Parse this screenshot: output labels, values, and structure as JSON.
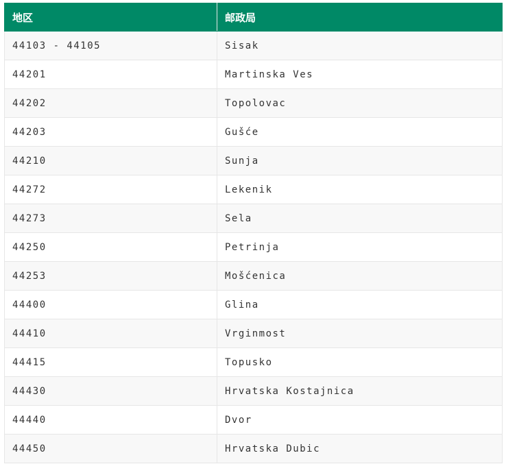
{
  "table": {
    "headers": [
      "地区",
      "邮政局"
    ],
    "rows": [
      {
        "code": "44103 - 44105",
        "office": "Sisak"
      },
      {
        "code": "44201",
        "office": "Martinska Ves"
      },
      {
        "code": "44202",
        "office": "Topolovac"
      },
      {
        "code": "44203",
        "office": "Gušće"
      },
      {
        "code": "44210",
        "office": "Sunja"
      },
      {
        "code": "44272",
        "office": "Lekenik"
      },
      {
        "code": "44273",
        "office": "Sela"
      },
      {
        "code": "44250",
        "office": "Petrinja"
      },
      {
        "code": "44253",
        "office": "Mošćenica"
      },
      {
        "code": "44400",
        "office": "Glina"
      },
      {
        "code": "44410",
        "office": "Vrginmost"
      },
      {
        "code": "44415",
        "office": "Topusko"
      },
      {
        "code": "44430",
        "office": "Hrvatska Kostajnica"
      },
      {
        "code": "44440",
        "office": "Dvor"
      },
      {
        "code": "44450",
        "office": "Hrvatska Dubic"
      }
    ]
  },
  "colors": {
    "header_bg": "#008966",
    "header_text": "#ffffff",
    "row_text": "#333333",
    "border": "#e6e6e6"
  }
}
